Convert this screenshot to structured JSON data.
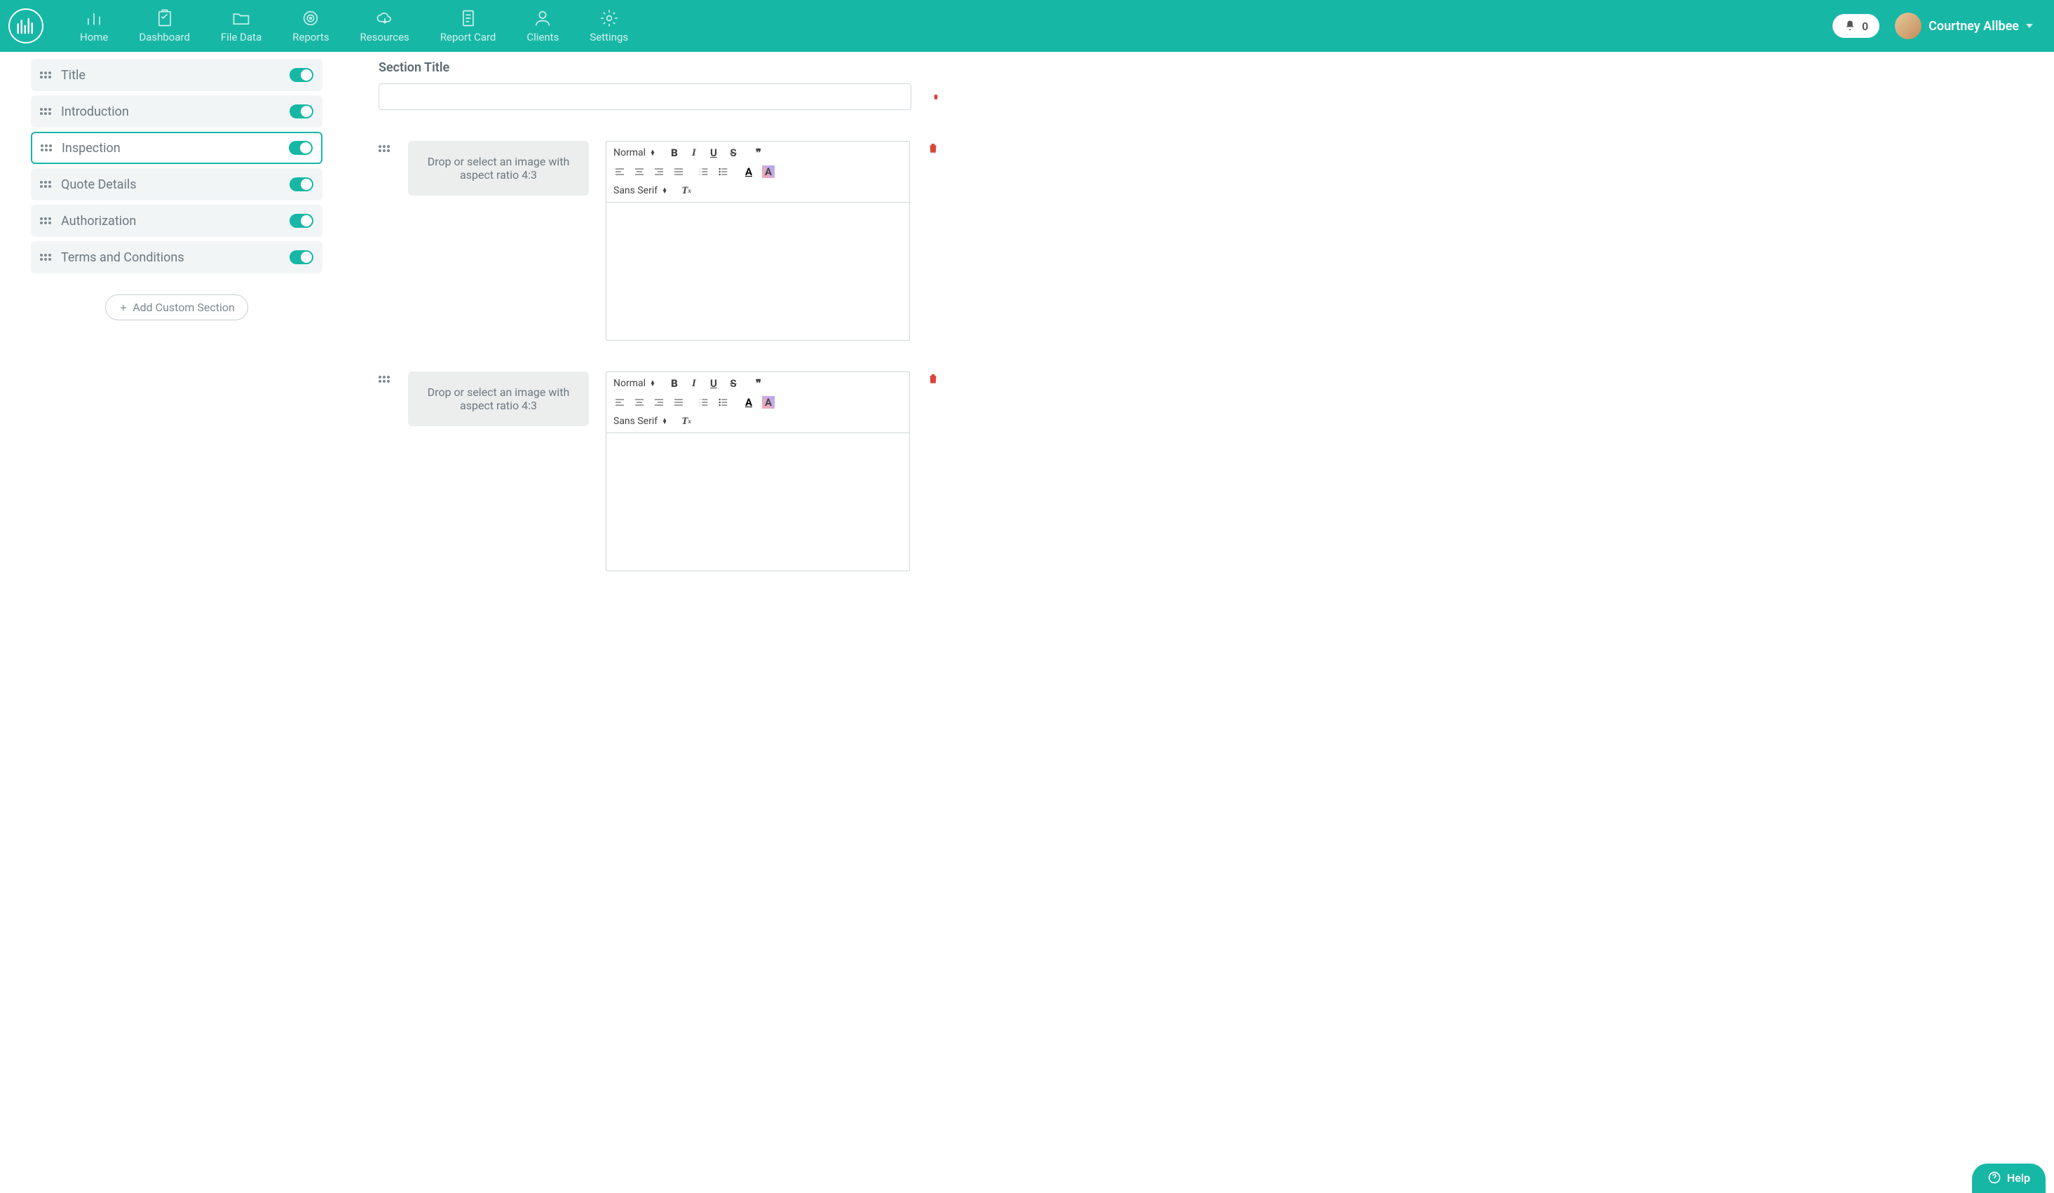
{
  "nav": {
    "items": [
      "Home",
      "Dashboard",
      "File Data",
      "Reports",
      "Resources",
      "Report Card",
      "Clients",
      "Settings"
    ],
    "notification_count": "0"
  },
  "user": {
    "name": "Courtney Allbee"
  },
  "sidebar": {
    "sections": [
      {
        "label": "Title",
        "active": false
      },
      {
        "label": "Introduction",
        "active": false
      },
      {
        "label": "Inspection",
        "active": true
      },
      {
        "label": "Quote Details",
        "active": false
      },
      {
        "label": "Authorization",
        "active": false
      },
      {
        "label": "Terms and Conditions",
        "active": false
      }
    ],
    "add_button": "Add Custom Section"
  },
  "editor": {
    "section_title_label": "Section Title",
    "section_title_value": "",
    "image_drop_text": "Drop or select an image with aspect ratio 4:3",
    "rte": {
      "heading_select": "Normal",
      "font_select": "Sans Serif"
    }
  },
  "help": {
    "label": "Help"
  },
  "colors": {
    "brand": "#17b7a6",
    "danger": "#d9453a"
  }
}
